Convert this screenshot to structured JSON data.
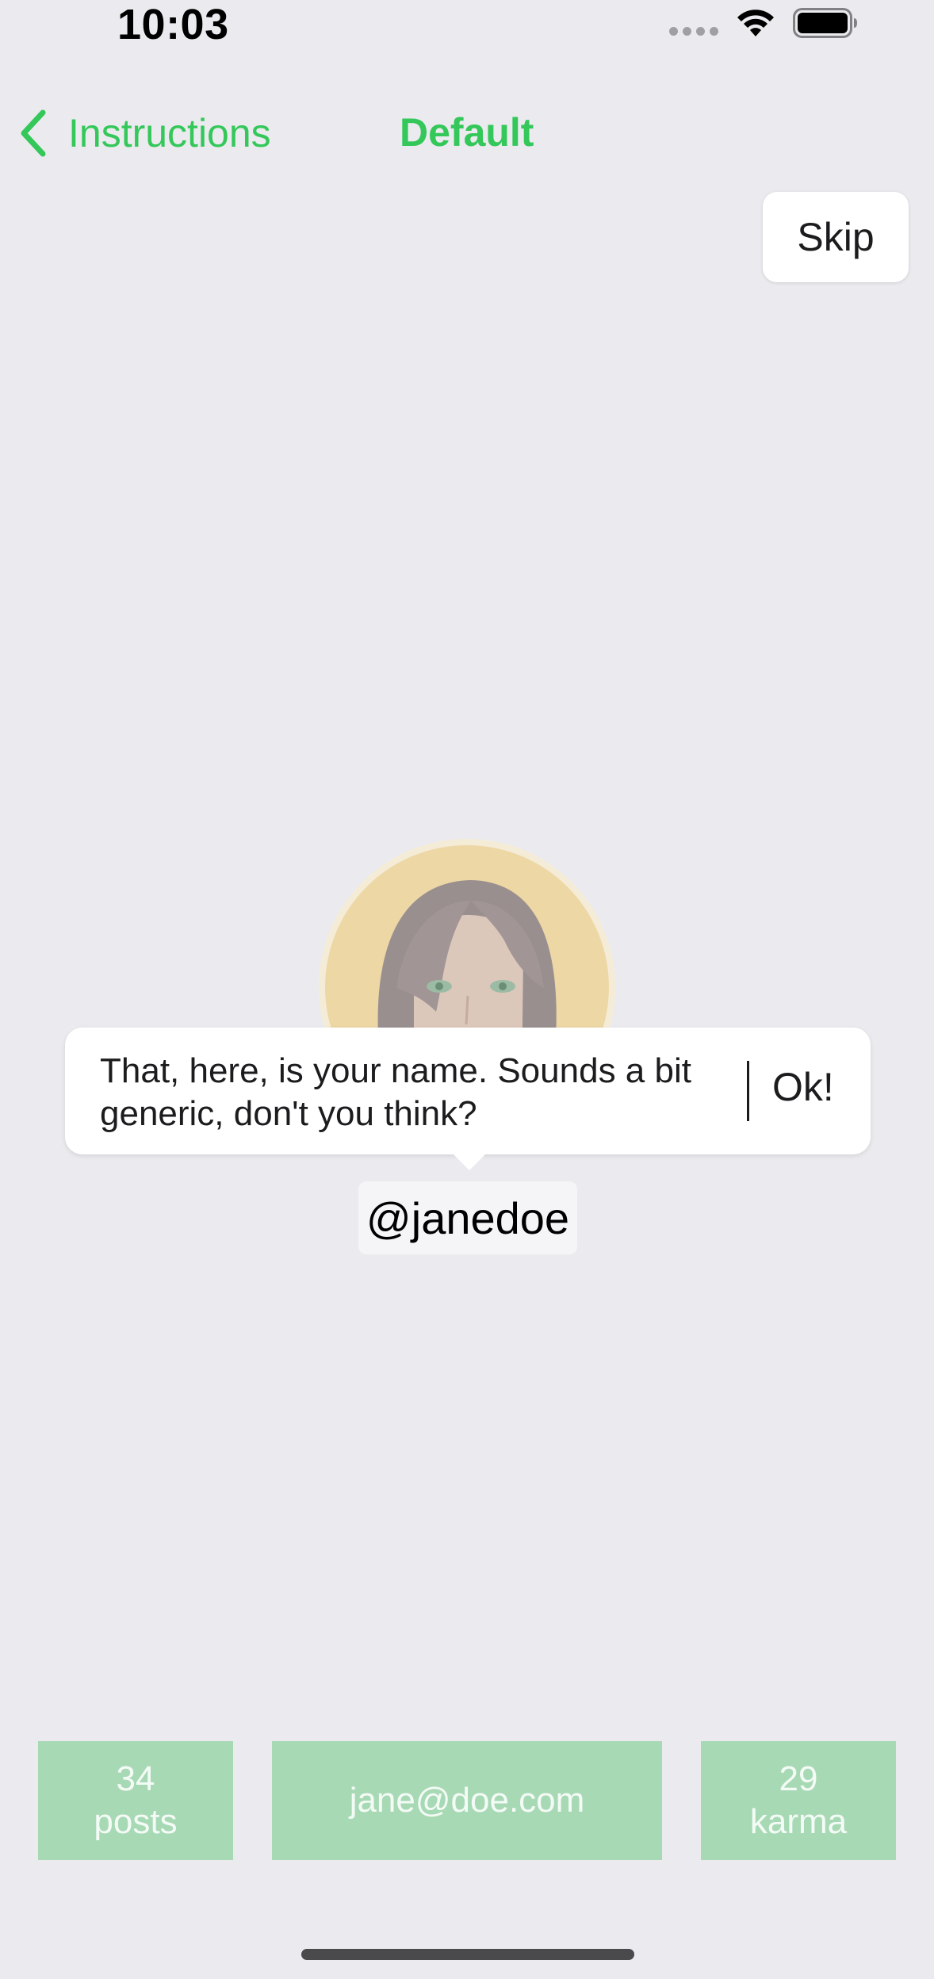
{
  "status_bar": {
    "time": "10:03"
  },
  "nav": {
    "back_label": "Instructions",
    "title": "Default"
  },
  "skip_label": "Skip",
  "tooltip": {
    "text": "That, here, is your name. Sounds a bit generic, don't you think?",
    "ok_label": "Ok!"
  },
  "profile": {
    "username": "@janedoe"
  },
  "stats": {
    "posts_count": "34",
    "posts_label": "posts",
    "email": "jane@doe.com",
    "karma_count": "29",
    "karma_label": "karma"
  },
  "colors": {
    "accent": "#34c759",
    "stat_background": "#a8d9b5",
    "background": "#ebebef"
  },
  "icons": {
    "back": "chevron-left-icon",
    "wifi": "wifi-icon",
    "battery": "battery-icon",
    "signal": "cellular-signal-icon"
  }
}
